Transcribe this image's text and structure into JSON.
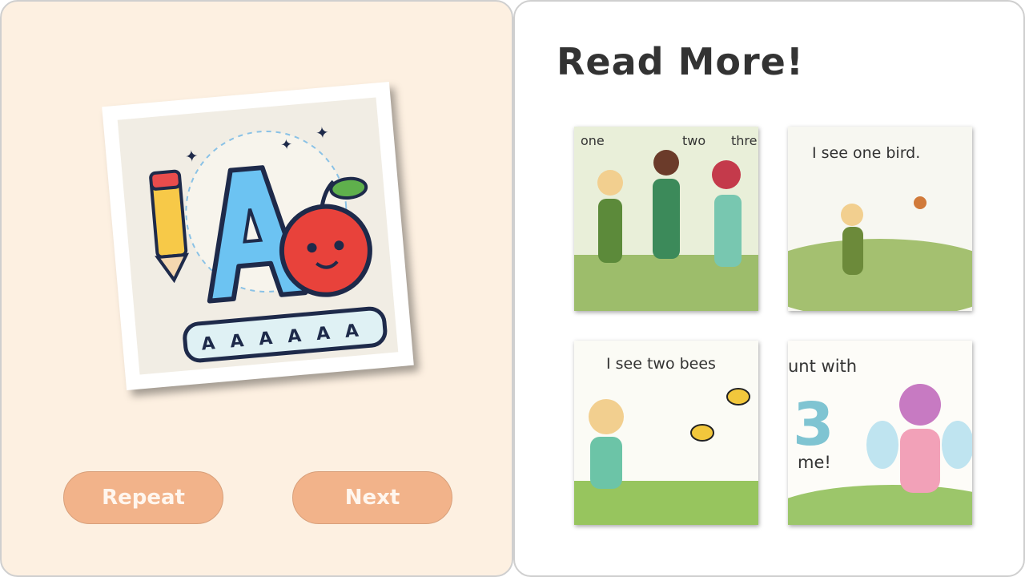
{
  "left": {
    "flashcard": {
      "icon": "letter-a-apple-pencil-illustration",
      "tiles": [
        "A",
        "A",
        "A",
        "A",
        "A",
        "A"
      ]
    },
    "buttons": {
      "repeat": "Repeat",
      "next": "Next"
    }
  },
  "right": {
    "heading": "Read More!",
    "books": [
      {
        "label_words": [
          "one",
          "two",
          "thre"
        ]
      },
      {
        "text": "I see one bird."
      },
      {
        "text": "I see two bees"
      },
      {
        "text_top": "unt with",
        "number": "3",
        "text_bottom": "me!"
      }
    ]
  },
  "colors": {
    "left_bg": "#fdf0e1",
    "button": "#f2b38a",
    "right_bg": "#ffffff"
  }
}
